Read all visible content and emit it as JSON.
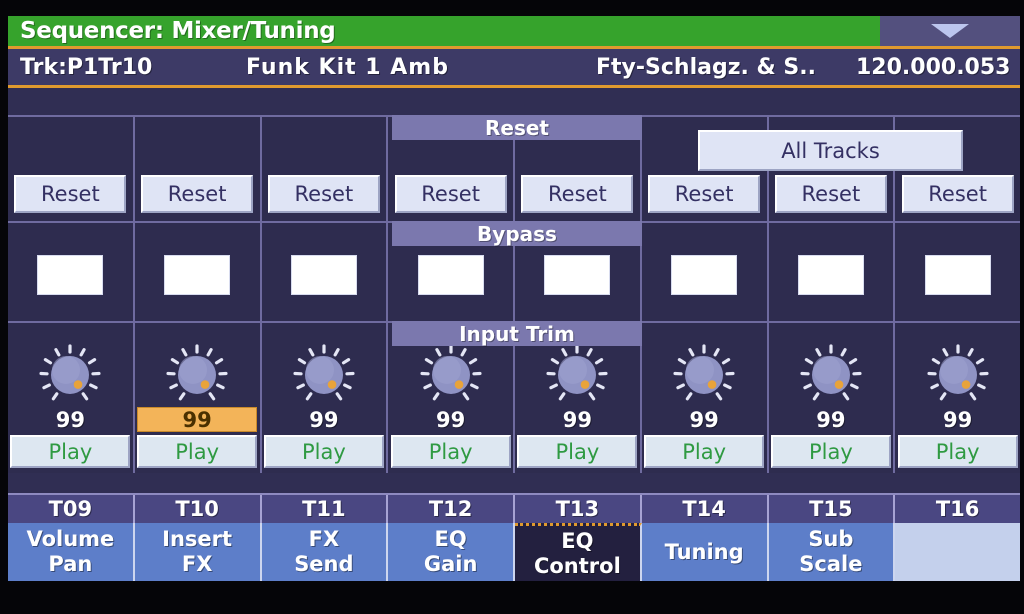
{
  "header": {
    "title": "Sequencer: Mixer/Tuning",
    "dropdown_icon": "chevron-down-icon",
    "track": "Trk:P1Tr10",
    "kit_name": "Funk Kit 1 Amb",
    "bank": "Fty-Schlagz. & S..",
    "tempo": "120.000.053"
  },
  "sections": {
    "reset_label": "Reset",
    "bypass_label": "Bypass",
    "input_trim_label": "Input Trim",
    "all_tracks_label": "All Tracks"
  },
  "colors": {
    "title_green": "#36a32c",
    "accent_orange": "#e09a2e",
    "screen_bg": "#302e53",
    "tab_blue": "#5d7ec9",
    "active_tab": "#23203f",
    "selected_value": "#f3b459",
    "play_green": "#2f9a42",
    "knob_body": "#8f93c4",
    "knob_indicator": "#e8a33a"
  },
  "channels": [
    {
      "track": "T09",
      "reset_label": "Reset",
      "bypass_checked": false,
      "trim_value": "99",
      "trim_selected": false,
      "play_label": "Play"
    },
    {
      "track": "T10",
      "reset_label": "Reset",
      "bypass_checked": false,
      "trim_value": "99",
      "trim_selected": true,
      "play_label": "Play"
    },
    {
      "track": "T11",
      "reset_label": "Reset",
      "bypass_checked": false,
      "trim_value": "99",
      "trim_selected": false,
      "play_label": "Play"
    },
    {
      "track": "T12",
      "reset_label": "Reset",
      "bypass_checked": false,
      "trim_value": "99",
      "trim_selected": false,
      "play_label": "Play"
    },
    {
      "track": "T13",
      "reset_label": "Reset",
      "bypass_checked": false,
      "trim_value": "99",
      "trim_selected": false,
      "play_label": "Play"
    },
    {
      "track": "T14",
      "reset_label": "Reset",
      "bypass_checked": false,
      "trim_value": "99",
      "trim_selected": false,
      "play_label": "Play"
    },
    {
      "track": "T15",
      "reset_label": "Reset",
      "bypass_checked": false,
      "trim_value": "99",
      "trim_selected": false,
      "play_label": "Play"
    },
    {
      "track": "T16",
      "reset_label": "Reset",
      "bypass_checked": false,
      "trim_value": "99",
      "trim_selected": false,
      "play_label": "Play"
    }
  ],
  "tabs": [
    {
      "line1": "Volume",
      "line2": "Pan",
      "active": false,
      "empty": false
    },
    {
      "line1": "Insert",
      "line2": "FX",
      "active": false,
      "empty": false
    },
    {
      "line1": "FX",
      "line2": "Send",
      "active": false,
      "empty": false
    },
    {
      "line1": "EQ",
      "line2": "Gain",
      "active": false,
      "empty": false
    },
    {
      "line1": "EQ",
      "line2": "Control",
      "active": true,
      "empty": false
    },
    {
      "line1": "Tuning",
      "line2": "",
      "active": false,
      "empty": false
    },
    {
      "line1": "Sub",
      "line2": "Scale",
      "active": false,
      "empty": false
    },
    {
      "line1": "",
      "line2": "",
      "active": false,
      "empty": true
    }
  ]
}
